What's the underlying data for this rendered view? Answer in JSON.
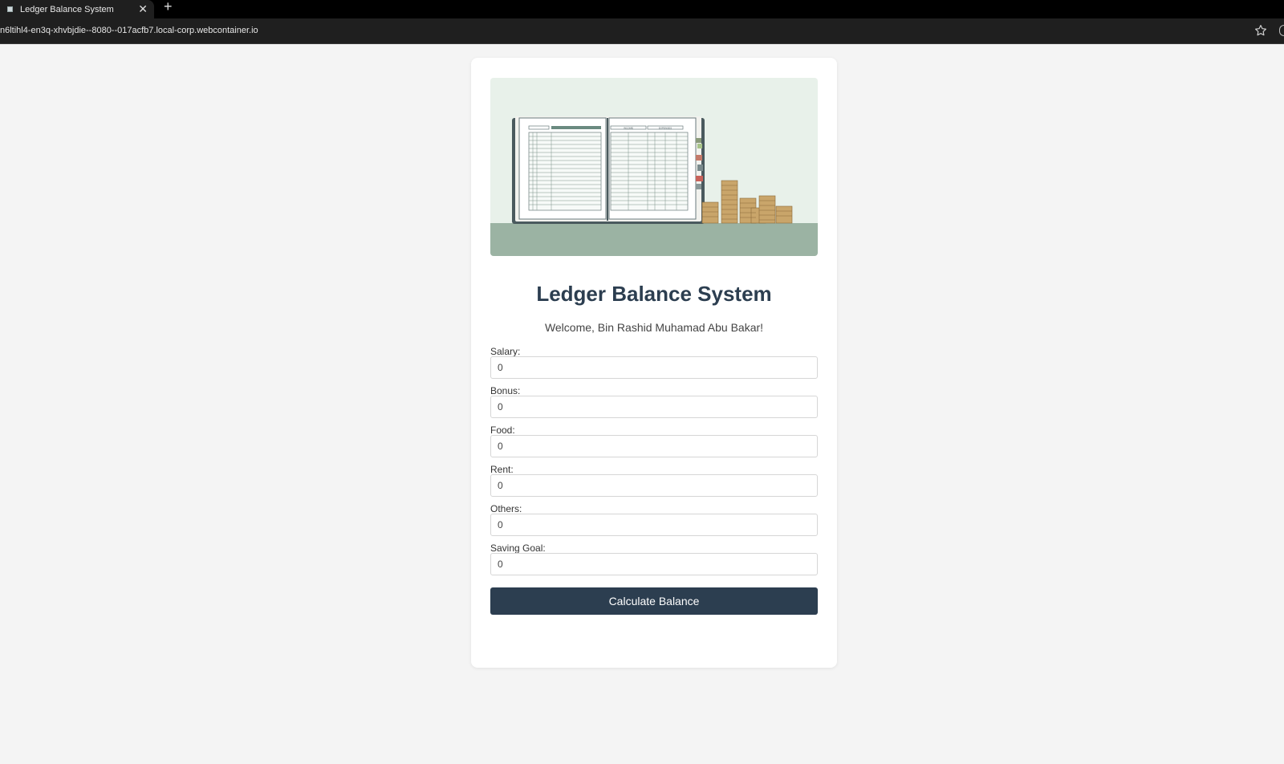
{
  "browser": {
    "tab_title": "Ledger Balance System",
    "close_glyph": "✕",
    "new_tab_glyph": "+",
    "url": "n6ltihl4-en3q-xhvbjdie--8080--017acfb7.local-corp.webcontainer.io"
  },
  "page": {
    "title": "Ledger Balance System",
    "welcome": "Welcome, Bin Rashid Muhamad Abu Bakar!"
  },
  "hero": {
    "header_income": "INCOME",
    "header_expenses": "EXPENSES"
  },
  "form": {
    "fields": [
      {
        "label": "Salary:",
        "value": "0"
      },
      {
        "label": "Bonus:",
        "value": "0"
      },
      {
        "label": "Food:",
        "value": "0"
      },
      {
        "label": "Rent:",
        "value": "0"
      },
      {
        "label": "Others:",
        "value": "0"
      },
      {
        "label": "Saving Goal:",
        "value": "0"
      }
    ],
    "submit_label": "Calculate Balance"
  },
  "colors": {
    "page_bg": "#f4f4f4",
    "card_bg": "#ffffff",
    "accent": "#2c3e50",
    "hero_bg": "#e8f1ea",
    "hero_table": "#9bb3a3"
  }
}
